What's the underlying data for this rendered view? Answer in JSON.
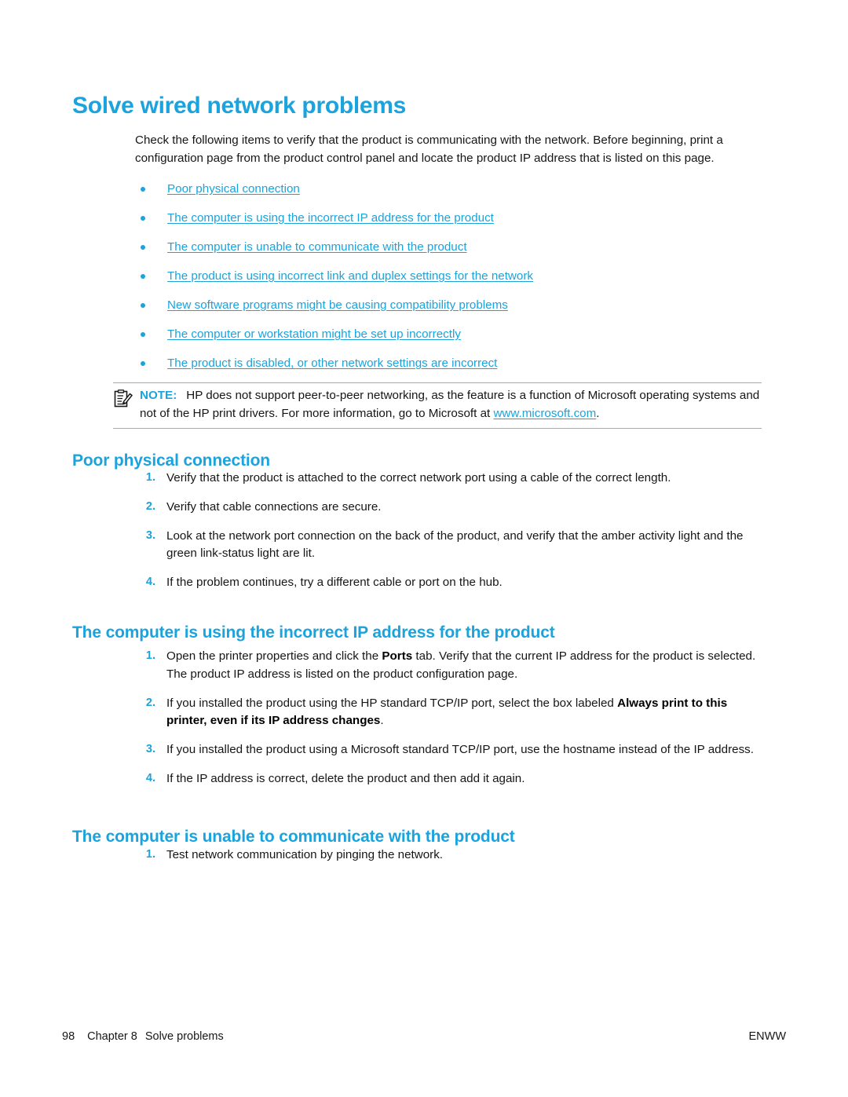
{
  "page_title": "Solve wired network problems",
  "intro": "Check the following items to verify that the product is communicating with the network. Before beginning, print a configuration page from the product control panel and locate the product IP address that is listed on this page.",
  "link_list": [
    {
      "label": "Poor physical connection"
    },
    {
      "label": "The computer is using the incorrect IP address for the product"
    },
    {
      "label": "The computer is unable to communicate with the product"
    },
    {
      "label": "The product is using incorrect link and duplex settings for the network"
    },
    {
      "label": "New software programs might be causing compatibility problems"
    },
    {
      "label": "The computer or workstation might be set up incorrectly"
    },
    {
      "label": "The product is disabled, or other network settings are incorrect"
    }
  ],
  "note": {
    "icon": "note-clipboard-pencil-icon",
    "label": "NOTE:",
    "text_before_link": "HP does not support peer-to-peer networking, as the feature is a function of Microsoft operating systems and not of the HP print drivers. For more information, go to Microsoft at ",
    "link": "www.microsoft.com",
    "text_after_link": "."
  },
  "sections": [
    {
      "heading": "Poor physical connection",
      "steps": [
        {
          "num": "1.",
          "text": "Verify that the product is attached to the correct network port using a cable of the correct length."
        },
        {
          "num": "2.",
          "text": "Verify that cable connections are secure."
        },
        {
          "num": "3.",
          "text": "Look at the network port connection on the back of the product, and verify that the amber activity light and the green link-status light are lit."
        },
        {
          "num": "4.",
          "text": "If the problem continues, try a different cable or port on the hub."
        }
      ]
    },
    {
      "heading": "The computer is using the incorrect IP address for the product",
      "steps": [
        {
          "num": "1.",
          "parts": [
            {
              "t": "Open the printer properties and click the ",
              "b": false
            },
            {
              "t": "Ports",
              "b": true
            },
            {
              "t": " tab. Verify that the current IP address for the product is selected. The product IP address is listed on the product configuration page.",
              "b": false
            }
          ]
        },
        {
          "num": "2.",
          "parts": [
            {
              "t": "If you installed the product using the HP standard TCP/IP port, select the box labeled ",
              "b": false
            },
            {
              "t": "Always print to this printer, even if its IP address changes",
              "b": true
            },
            {
              "t": ".",
              "b": false
            }
          ]
        },
        {
          "num": "3.",
          "text": "If you installed the product using a Microsoft standard TCP/IP port, use the hostname instead of the IP address."
        },
        {
          "num": "4.",
          "text": "If the IP address is correct, delete the product and then add it again."
        }
      ]
    },
    {
      "heading": "The computer is unable to communicate with the product",
      "steps": [
        {
          "num": "1.",
          "text": "Test network communication by pinging the network."
        }
      ]
    }
  ],
  "footer": {
    "page_number": "98",
    "chapter": "Chapter 8",
    "chapter_title": "Solve problems",
    "right": "ENWW"
  },
  "colors": {
    "accent_blue": "#1aa3dd",
    "rule_blue": "#67bfe8",
    "body_text": "#161616"
  }
}
